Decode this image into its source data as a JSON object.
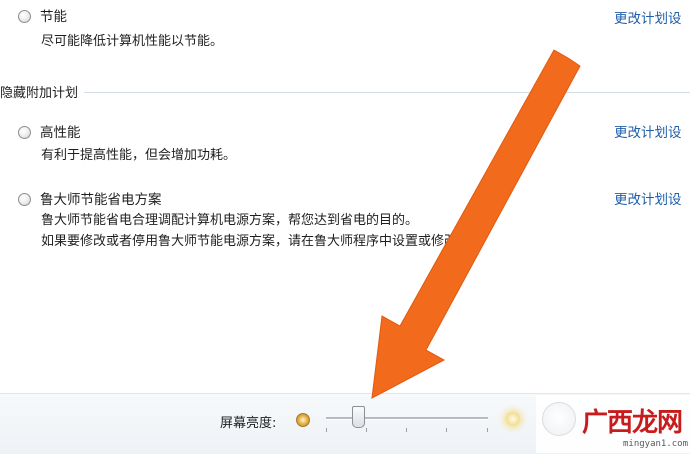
{
  "plans": [
    {
      "name": "节能",
      "desc": [
        "尽可能降低计算机性能以节能。"
      ],
      "link": "更改计划设"
    }
  ],
  "hidden_section": {
    "title": "隐藏附加计划",
    "plans": [
      {
        "name": "高性能",
        "desc": [
          "有利于提高性能，但会增加功耗。"
        ],
        "link": "更改计划设"
      },
      {
        "name": "鲁大师节能省电方案",
        "desc": [
          "鲁大师节能省电合理调配计算机电源方案，帮您达到省电的目的。",
          "如果要修改或者停用鲁大师节能电源方案，请在鲁大师程序中设置或修改。"
        ],
        "link": "更改计划设"
      }
    ]
  },
  "brightness": {
    "label": "屏幕亮度:",
    "level_fraction": 0.2
  },
  "watermark": {
    "name": "广西龙网",
    "url": "mingyan1.com"
  },
  "colors": {
    "link": "#1f5ea8",
    "arrow": "#f26a1b",
    "watermark": "#c81c1c"
  },
  "icons": {
    "radio": "radio-button",
    "dim": "sun-dim-icon",
    "bright": "sun-bright-icon"
  }
}
